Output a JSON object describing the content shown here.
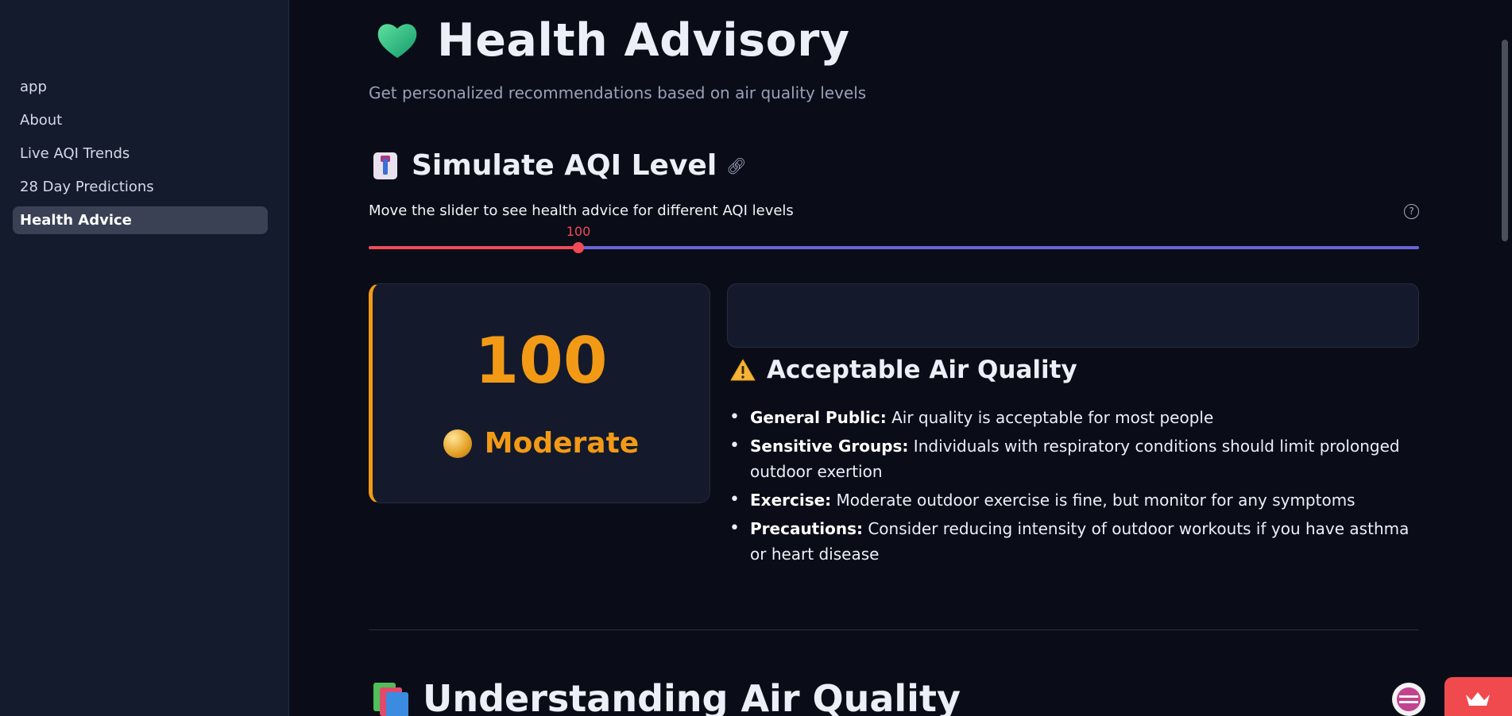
{
  "sidebar": {
    "items": [
      {
        "label": "app",
        "active": false
      },
      {
        "label": "About",
        "active": false
      },
      {
        "label": "Live AQI Trends",
        "active": false
      },
      {
        "label": "28 Day Predictions",
        "active": false
      },
      {
        "label": "Health Advice",
        "active": true
      }
    ]
  },
  "header": {
    "title": "Health Advisory",
    "title_icon": "green-heart-icon",
    "subtitle": "Get personalized recommendations based on air quality levels"
  },
  "simulate": {
    "title": "Simulate AQI Level",
    "title_icon": "thermometer-icon",
    "slider_label": "Move the slider to see health advice for different AQI levels",
    "slider_value": "100",
    "slider_fraction": 0.2,
    "colors": {
      "fill": "#ef4b57",
      "rest": "#6b64d8"
    }
  },
  "aqi_card": {
    "value": "100",
    "category": "Moderate",
    "category_icon": "orange-circle-icon",
    "accent_color": "#f29a16"
  },
  "advice": {
    "title": "Acceptable Air Quality",
    "title_icon": "warning-icon",
    "items": [
      {
        "label": "General Public:",
        "text": " Air quality is acceptable for most people"
      },
      {
        "label": "Sensitive Groups:",
        "text": " Individuals with respiratory conditions should limit prolonged outdoor exertion"
      },
      {
        "label": "Exercise:",
        "text": " Moderate outdoor exercise is fine, but monitor for any symptoms"
      },
      {
        "label": "Precautions:",
        "text": " Consider reducing intensity of outdoor workouts if you have asthma or heart disease"
      }
    ]
  },
  "understanding": {
    "title": "Understanding Air Quality",
    "title_icon": "books-icon"
  }
}
